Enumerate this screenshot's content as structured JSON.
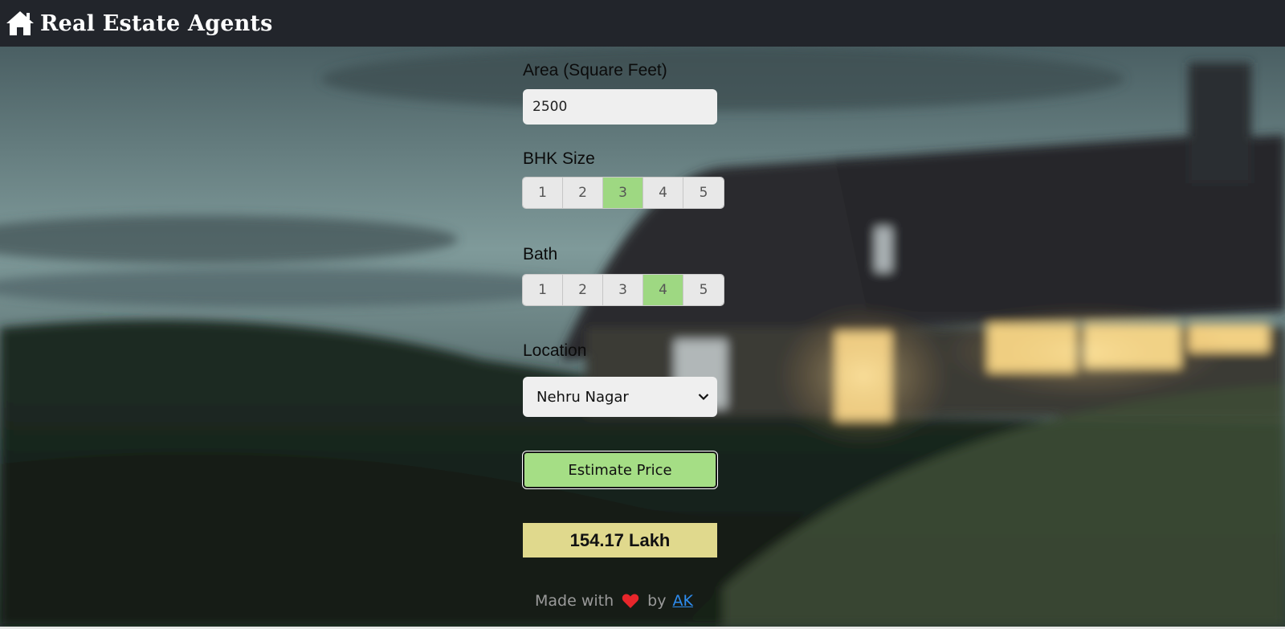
{
  "navbar": {
    "brand_icon": "home-icon",
    "title": "Real Estate Agents"
  },
  "form": {
    "area": {
      "label": "Area (Square Feet)",
      "value": "2500"
    },
    "bhk": {
      "label": "BHK Size",
      "options": [
        "1",
        "2",
        "3",
        "4",
        "5"
      ],
      "selected": "3"
    },
    "bath": {
      "label": "Bath",
      "options": [
        "1",
        "2",
        "3",
        "4",
        "5"
      ],
      "selected": "4"
    },
    "location": {
      "label": "Location",
      "selected": "Nehru Nagar",
      "icon": "chevron-down-icon"
    },
    "estimate_button": "Estimate Price",
    "result": "154.17 Lakh"
  },
  "footer": {
    "made_with": "Made with",
    "heart_icon": "heart-icon",
    "by": "by",
    "author": "AK"
  },
  "colors": {
    "navbar": "#22252b",
    "selected_segment": "#9ed882",
    "estimate_button": "#a5de85",
    "result_box": "#e0d98d",
    "link": "#2e8df0"
  }
}
